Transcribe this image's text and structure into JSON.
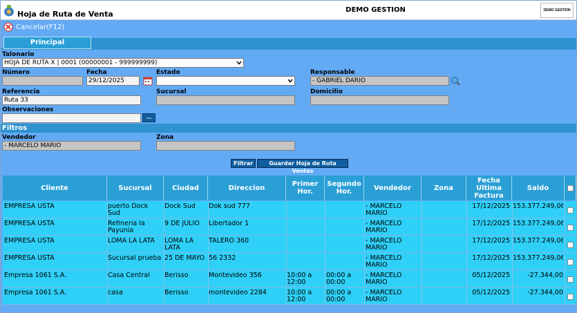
{
  "header": {
    "title": "Hoja de Ruta de Venta",
    "company": "DEMO GESTION",
    "logo_text": "DEMO GESTION"
  },
  "toolbar": {
    "cancel_label": "Cancelar(F12)"
  },
  "tabs": [
    {
      "label": "Principal"
    }
  ],
  "form": {
    "talonario": {
      "label": "Talonario",
      "value": "HOJA DE RUTA X | 0001 (00000001 - 999999999)"
    },
    "numero": {
      "label": "Número",
      "value": ""
    },
    "fecha": {
      "label": "Fecha",
      "value": "29/12/2025"
    },
    "estado": {
      "label": "Estado",
      "value": ""
    },
    "responsable": {
      "label": "Responsable",
      "value": "- GABRIEL DARIO"
    },
    "referencia": {
      "label": "Referencia",
      "value": "Ruta 33"
    },
    "sucursal": {
      "label": "Sucursal",
      "value": ""
    },
    "domicilio": {
      "label": "Domicilio",
      "value": ""
    },
    "observaciones": {
      "label": "Observaciones",
      "value": "",
      "button": "..."
    }
  },
  "filters": {
    "section_title": "Filtros",
    "vendedor": {
      "label": "Vendedor",
      "value": "- MARCELO MARIO"
    },
    "zona": {
      "label": "Zona",
      "value": ""
    },
    "filter_button": "Filtrar",
    "save_button": "Guardar Hoja de Ruta Ventas"
  },
  "table": {
    "columns": [
      "Cliente",
      "Sucursal",
      "Ciudad",
      "Direccion",
      "Primer Hor.",
      "Segundo Hor.",
      "Vendedor",
      "Zona",
      "Fecha Ultima Factura",
      "Saldo"
    ],
    "rows": [
      {
        "cliente": "EMPRESA USTA",
        "sucursal": "puerto Dock Sud",
        "ciudad": "Dock Sud",
        "direccion": "Dok sud 777",
        "primer": "",
        "segundo": "",
        "vendedor": "- MARCELO MARIO",
        "zona": "",
        "fecha": "17/12/2025",
        "saldo": "153.377.249,06"
      },
      {
        "cliente": "EMPRESA USTA",
        "sucursal": "Refineria la Payunia",
        "ciudad": "9 DE JULIO",
        "direccion": "Libertador 1",
        "primer": "",
        "segundo": "",
        "vendedor": "- MARCELO MARIO",
        "zona": "",
        "fecha": "17/12/2025",
        "saldo": "153.377.249,06"
      },
      {
        "cliente": "EMPRESA USTA",
        "sucursal": "LOMA LA LATA",
        "ciudad": "LOMA LA LATA",
        "direccion": "TALERO 360",
        "primer": "",
        "segundo": "",
        "vendedor": "- MARCELO MARIO",
        "zona": "",
        "fecha": "17/12/2025",
        "saldo": "153.377.249,06"
      },
      {
        "cliente": "EMPRESA USTA",
        "sucursal": "Sucursal prueba",
        "ciudad": "25 DE MAYO",
        "direccion": "56 2332",
        "primer": "",
        "segundo": "",
        "vendedor": "- MARCELO MARIO",
        "zona": "",
        "fecha": "17/12/2025",
        "saldo": "153.377.249,06"
      },
      {
        "cliente": "Empresa 1061 S.A.",
        "sucursal": "Casa Central",
        "ciudad": "Berisso",
        "direccion": "Montevideo 356",
        "primer": "10:00 a 12:00",
        "segundo": "00:00 a 00:00",
        "vendedor": "- MARCELO MARIO",
        "zona": "",
        "fecha": "05/12/2025",
        "saldo": "-27.344,00"
      },
      {
        "cliente": "Empresa 1061 S.A.",
        "sucursal": "casa",
        "ciudad": "Berisso",
        "direccion": "montevideo 2284",
        "primer": "10:00 a 12:00",
        "segundo": "00:00 a 00:00",
        "vendedor": "- MARCELO MARIO",
        "zona": "",
        "fecha": "05/12/2025",
        "saldo": "-27.344,00"
      }
    ]
  }
}
